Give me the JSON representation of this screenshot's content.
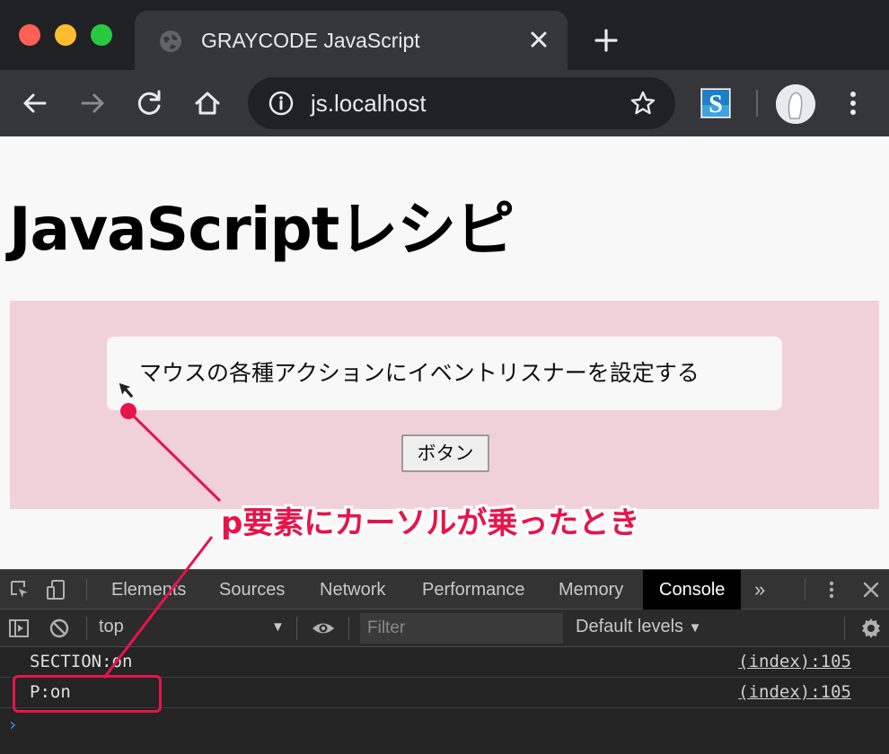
{
  "browser": {
    "tab_title": "GRAYCODE JavaScript",
    "url": "js.localhost",
    "extension_letter": "S"
  },
  "page": {
    "heading": "JavaScriptレシピ",
    "paragraph": "マウスの各種アクションにイベントリスナーを設定する",
    "button_label": "ボタン",
    "colors": {
      "section_bg": "#f1d1d9",
      "page_bg": "#f8f8f8"
    }
  },
  "devtools": {
    "tabs": [
      "Elements",
      "Sources",
      "Network",
      "Performance",
      "Memory",
      "Console"
    ],
    "active_tab": "Console",
    "more_tabs_glyph": "»",
    "context": "top",
    "filter_placeholder": "Filter",
    "levels": "Default levels",
    "logs": [
      {
        "message": "SECTION:on",
        "source": "(index):105"
      },
      {
        "message": "P:on",
        "source": "(index):105"
      }
    ],
    "prompt": "›"
  },
  "annotation": {
    "label": "p要素にカーソルが乗ったとき",
    "color": "#e6144a"
  }
}
